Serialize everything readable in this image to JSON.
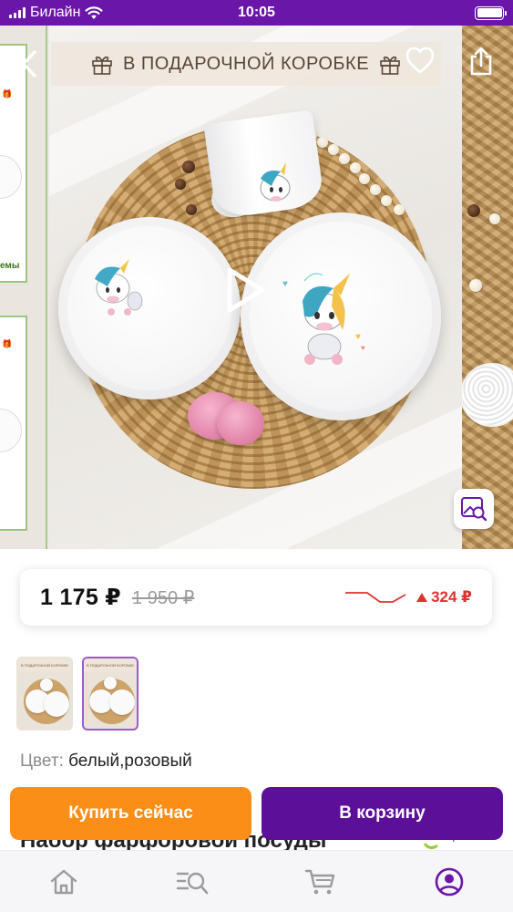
{
  "status_bar": {
    "carrier": "Билайн",
    "time": "10:05"
  },
  "gallery": {
    "banner_text": "В ПОДАРОЧНОЙ КОРОБКЕ",
    "side_caption": "емы",
    "icons": [
      "back-arrow-icon",
      "heart-icon",
      "share-icon",
      "play-icon",
      "image-search-icon",
      "gift-icon"
    ]
  },
  "price": {
    "current": "1 175 ₽",
    "old": "1 950 ₽",
    "diff": "324 ₽",
    "trend_color": "#e0312f"
  },
  "thumbnails": [
    {
      "label": "В ПОДАРОЧНОЙ КОРОБКЕ",
      "selected": false
    },
    {
      "label": "В ПОДАРОЧНОЙ КОРОБКЕ",
      "selected": true
    }
  ],
  "color": {
    "label": "Цвет:",
    "value": "белый,розовый"
  },
  "product_title": "Набор фарфоровой посуды",
  "actions": {
    "buy_now": "Купить сейчас",
    "add_to_cart": "В корзину",
    "buy_now_color": "#fb8e17",
    "add_to_cart_color": "#5c0f99"
  },
  "bottom_nav": {
    "items": [
      "home-icon",
      "catalog-search-icon",
      "cart-icon",
      "profile-icon"
    ],
    "active": "profile-icon",
    "accent": "#6a16a8"
  }
}
